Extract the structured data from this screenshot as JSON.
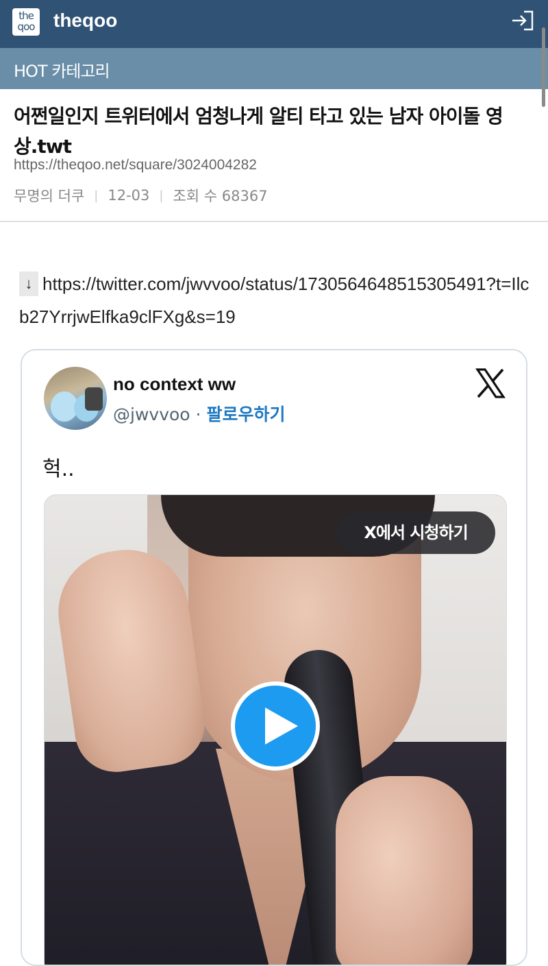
{
  "appbar": {
    "logo_line1": "the",
    "logo_line2": "qoo",
    "brand": "theqoo",
    "login_icon": "login-icon",
    "color": "#2f5275"
  },
  "category_bar": {
    "label": "HOT 카테고리",
    "color": "#6a8ea8"
  },
  "post": {
    "title": "어쩐일인지 트위터에서 엄청나게 알티 타고 있는 남자 아이돌 영상.twt",
    "url": "https://theqoo.net/square/3024004282",
    "author": "무명의 더쿠",
    "date": "12-03",
    "views": "조회 수 68367",
    "separator": "|"
  },
  "body": {
    "arrow": "↓",
    "link": "https://twitter.com/jwvvoo/status/1730564648515305491?t=Ilcb27YrrjwElfka9clFXg&s=19"
  },
  "tweet": {
    "display_name": "no context ww",
    "handle": "@jwvvoo",
    "dot": "·",
    "follow_label": "팔로우하기",
    "text": "헉..",
    "watch_label": "X에서 시청하기",
    "play_icon": "play-icon",
    "x_logo": "x-logo-icon",
    "accent": "#1d9bf0"
  }
}
